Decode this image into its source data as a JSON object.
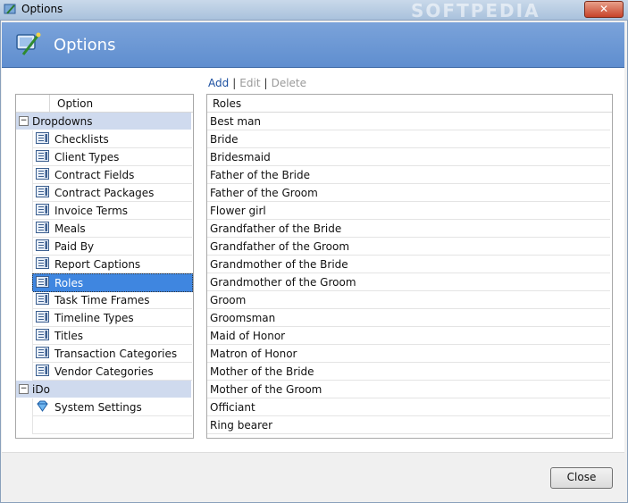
{
  "window": {
    "title": "Options",
    "close_glyph": "✕",
    "watermark": "SOFTPEDIA"
  },
  "header": {
    "title": "Options",
    "icon": "options-wand-icon"
  },
  "actions": {
    "add": "Add",
    "edit": "Edit",
    "delete": "Delete",
    "separator": "|"
  },
  "tree": {
    "column_header": "Option",
    "groups": [
      {
        "label": "Dropdowns",
        "toggle": "−",
        "items": [
          "Checklists",
          "Client Types",
          "Contract Fields",
          "Contract Packages",
          "Invoice Terms",
          "Meals",
          "Paid By",
          "Report Captions",
          "Roles",
          "Task Time Frames",
          "Timeline Types",
          "Titles",
          "Transaction Categories",
          "Vendor Categories"
        ]
      },
      {
        "label": "iDo",
        "toggle": "−",
        "items": [
          "System Settings"
        ]
      }
    ],
    "selected": "Roles"
  },
  "list": {
    "column_header": "Roles",
    "rows": [
      "Best man",
      "Bride",
      "Bridesmaid",
      "Father of the Bride",
      "Father of the Groom",
      "Flower girl",
      "Grandfather of the Bride",
      "Grandfather of the Groom",
      "Grandmother of the Bride",
      "Grandmother of the Groom",
      "Groom",
      "Groomsman",
      "Maid of Honor",
      "Matron of Honor",
      "Mother of the Bride",
      "Mother of the Groom",
      "Officiant",
      "Ring bearer"
    ]
  },
  "footer": {
    "close_label": "Close"
  },
  "colors": {
    "header_bg": "#6b98d4",
    "selection": "#3f86e0",
    "group_bg": "#cfdaee",
    "link": "#1b4fa0"
  }
}
